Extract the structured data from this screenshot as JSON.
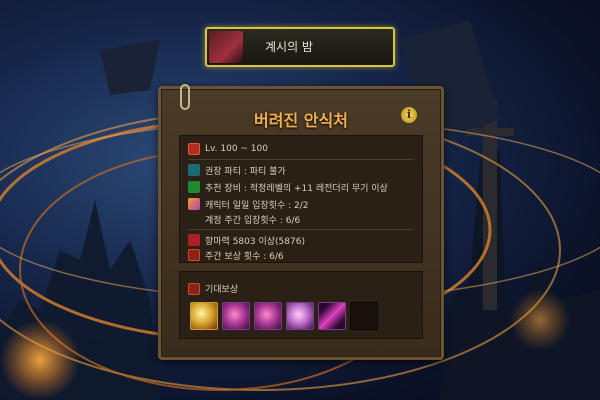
{
  "banner": {
    "title": "계시의 밤"
  },
  "panel": {
    "title": "버려진 안식처",
    "info_icon": "i",
    "info_rows": [
      {
        "icon": "level-icon",
        "text": "Lv. 100 ~ 100"
      },
      {
        "icon": "party-icon",
        "text": "권장 파티 : 파티 불가"
      },
      {
        "icon": "weapon-icon",
        "text": "추천 장비 : 적정레벨의 +11 레전더리 무기 이상"
      },
      {
        "icon": "entry-icon",
        "text": "캐릭터 일일 입장횟수 : 2/2"
      },
      {
        "icon": "",
        "text": "계정 주간 입장횟수 : 6/6"
      },
      {
        "icon": "power-icon",
        "text": "항마력 5803 이상(5876)"
      },
      {
        "icon": "chest-icon",
        "text": "주간 보상 횟수 : 6/6"
      }
    ],
    "reward": {
      "label": "기대보상",
      "slots": [
        "gold-item",
        "purple-orb",
        "purple-orb",
        "purple-armor",
        "purple-sword",
        "empty"
      ]
    }
  }
}
